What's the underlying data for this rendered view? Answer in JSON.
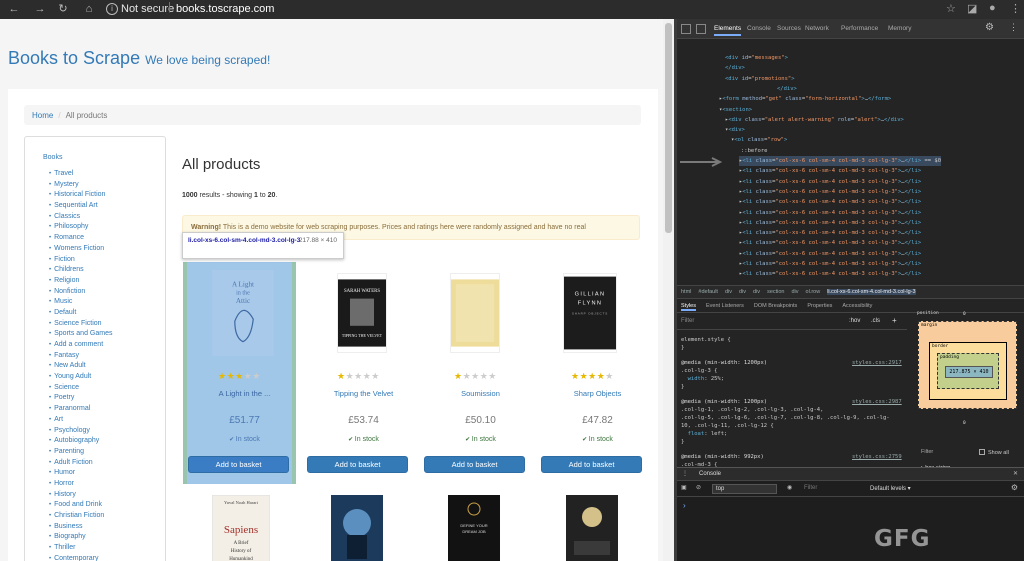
{
  "browser": {
    "secure_label": "Not secure",
    "url": "books.toscrape.com"
  },
  "site": {
    "brand": "Books to Scrape",
    "tagline": "We love being scraped!"
  },
  "breadcrumb": {
    "home": "Home",
    "current": "All products"
  },
  "sidebar": {
    "heading": "Books",
    "categories": [
      "Travel",
      "Mystery",
      "Historical Fiction",
      "Sequential Art",
      "Classics",
      "Philosophy",
      "Romance",
      "Womens Fiction",
      "Fiction",
      "Childrens",
      "Religion",
      "Nonfiction",
      "Music",
      "Default",
      "Science Fiction",
      "Sports and Games",
      "Add a comment",
      "Fantasy",
      "New Adult",
      "Young Adult",
      "Science",
      "Poetry",
      "Paranormal",
      "Art",
      "Psychology",
      "Autobiography",
      "Parenting",
      "Adult Fiction",
      "Humor",
      "Horror",
      "History",
      "Food and Drink",
      "Christian Fiction",
      "Business",
      "Biography",
      "Thriller",
      "Contemporary"
    ]
  },
  "main": {
    "heading": "All products",
    "results_count": "1000",
    "results_mid": " results - showing ",
    "results_from": "1",
    "results_to_word": " to ",
    "results_to": "20",
    "results_end": "."
  },
  "alert": {
    "strong": "Warning!",
    "text": " This is a demo website for web scraping purposes. Prices and ratings here were randomly assigned and have no real"
  },
  "tooltip": {
    "selector": "li.col-xs-6.col-sm-4.col-md-3.col-lg-3",
    "dims": "217.88 × 410"
  },
  "products": [
    {
      "title": "A Light in the ...",
      "price": "£51.77",
      "stock": "In stock",
      "rating": 3,
      "cover_title": "A Light in the Attic",
      "button": "Add to basket"
    },
    {
      "title": "Tipping the Velvet",
      "price": "£53.74",
      "stock": "In stock",
      "rating": 1,
      "cover_title": "SARAH WATERS",
      "cover_sub": "TIPPING THE VELVET",
      "button": "Add to basket"
    },
    {
      "title": "Soumission",
      "price": "£50.10",
      "stock": "In stock",
      "rating": 1,
      "button": "Add to basket"
    },
    {
      "title": "Sharp Objects",
      "price": "£47.82",
      "stock": "In stock",
      "rating": 4,
      "cover_title": "GILLIAN FLYNN",
      "button": "Add to basket"
    }
  ],
  "row2": {
    "sapiens_author": "Yuval Noah Harari",
    "sapiens_title": "Sapiens",
    "sapiens_sub": "A Brief History of Humankind"
  },
  "devtools": {
    "tabs": [
      "Elements",
      "Console",
      "Sources",
      "Network",
      "Performance",
      "Memory"
    ],
    "crumbs": [
      "html",
      "#default",
      "div",
      "div",
      "div",
      "section",
      "div",
      "ol.row",
      "li.col-xs-6.col-sm-4.col-md-3.col-lg-3"
    ],
    "subtabs": [
      "Styles",
      "Event Listeners",
      "DOM Breakpoints",
      "Properties",
      "Accessibility"
    ],
    "filter_placeholder": "Filter",
    "hov": ":hov",
    "cls": ".cls",
    "box_position": "position",
    "box_margin": "margin",
    "box_border": "border",
    "box_padding": "padding",
    "box_content": "217.875 × 410",
    "computed_filter": "Filter",
    "show_all": "Show all",
    "box_sizing": "box-sizing",
    "console_title": "Console",
    "console_context": "top",
    "console_filter": "Filter",
    "console_levels": "Default levels ▾"
  },
  "watermark": "GFG"
}
